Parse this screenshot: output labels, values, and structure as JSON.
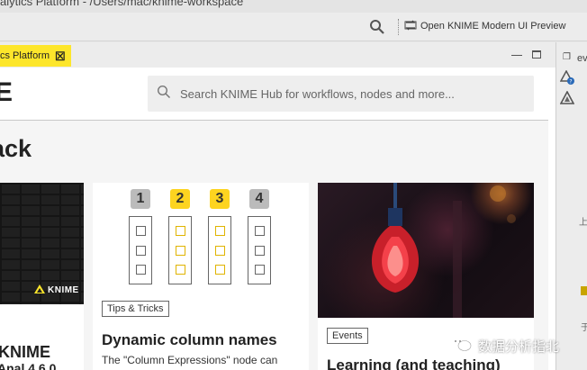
{
  "window": {
    "title": "alytics Platform - /Users/mac/knime-workspace"
  },
  "toolbar": {
    "open_modern_ui_label": "Open KNIME Modern UI Preview"
  },
  "editor_tab": {
    "label": "cs Platform"
  },
  "hub_header": {
    "logo_fragment": "E",
    "search_placeholder": "Search KNIME Hub for workflows, nodes and more..."
  },
  "page": {
    "heading_fragment": "ack"
  },
  "cards": [
    {
      "brand": "KNIME",
      "title": "KNIME",
      "subtitle": "Anal 4.6.0"
    },
    {
      "column_numbers": [
        "1",
        "2",
        "3",
        "4"
      ],
      "tag": "Tips & Tricks",
      "title": "Dynamic column names",
      "text": "The \"Column Expressions\" node can"
    },
    {
      "tag": "Events",
      "title": "Learning (and teaching)"
    }
  ],
  "right_panel": {
    "label": "ev",
    "side_text_1": "上",
    "side_text_3": "于"
  },
  "watermark": {
    "text": "数据分析指北"
  },
  "colors": {
    "knime_yellow": "#fde62b",
    "accent_yellow": "#fdd420",
    "card_bg": "#ffffff",
    "page_bg": "#f5f5f5"
  }
}
